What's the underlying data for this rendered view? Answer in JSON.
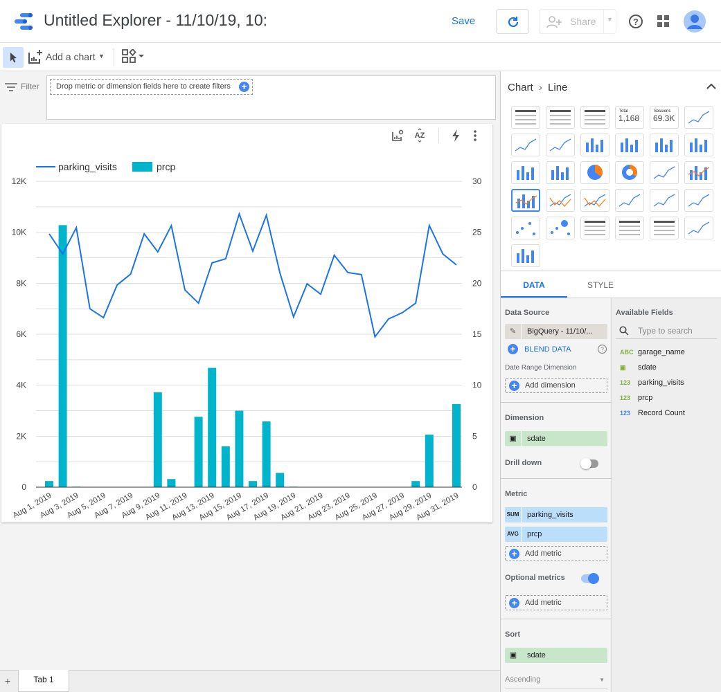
{
  "header": {
    "title": "Untitled Explorer - 11/10/19, 10:",
    "save_label": "Save",
    "share_label": "Share",
    "brand_color": "#4285f4"
  },
  "toolbar": {
    "add_chart_label": "Add a chart"
  },
  "filter": {
    "label": "Filter",
    "drop_hint": "Drop metric or dimension fields here to create filters"
  },
  "panel": {
    "breadcrumb_root": "Chart",
    "breadcrumb_leaf": "Line",
    "chart_types": [
      "table",
      "table-bars",
      "table-heatmap",
      "scorecard",
      "scorecard-compact",
      "time-series",
      "sparkline",
      "smoothed-time-series",
      "column",
      "stacked-column",
      "100-stacked-column",
      "bar",
      "stacked-bar",
      "100-stacked-bar",
      "pie",
      "donut",
      "geo-map",
      "combo",
      "stacked-combo",
      "line",
      "smoothed-line",
      "area",
      "stacked-area",
      "100-stacked-area",
      "scatter",
      "bubble",
      "pivot-table",
      "pivot-table-bars",
      "pivot-table-heatmap",
      "bullet",
      "treemap"
    ],
    "selected_chart_type": "stacked-combo",
    "scorecard1": {
      "label": "Total",
      "value": "1,168"
    },
    "scorecard2": {
      "label": "Sessions",
      "value": "69.3K"
    },
    "tabs": [
      "DATA",
      "STYLE"
    ],
    "active_tab": "DATA",
    "data_source_label": "Data Source",
    "data_source": "BigQuery - 11/10/...",
    "blend_label": "BLEND DATA",
    "date_range_label": "Date Range Dimension",
    "add_dimension": "Add dimension",
    "dimension_label": "Dimension",
    "dimension": "sdate",
    "drill_down_label": "Drill down",
    "drill_down_on": false,
    "metric_label": "Metric",
    "metrics": [
      {
        "agg": "SUM",
        "name": "parking_visits"
      },
      {
        "agg": "AVG",
        "name": "prcp"
      }
    ],
    "add_metric": "Add metric",
    "optional_metrics_label": "Optional metrics",
    "optional_metrics_on": true,
    "sort_label": "Sort",
    "sort_field": "sdate",
    "sort_order": "Ascending",
    "available_fields_label": "Available Fields",
    "search_placeholder": "Type to search",
    "fields": [
      {
        "type": "ABC",
        "name": "garage_name",
        "color": "#7cb342"
      },
      {
        "type": "date",
        "name": "sdate",
        "color": "#7cb342"
      },
      {
        "type": "123",
        "name": "parking_visits",
        "color": "#7cb342"
      },
      {
        "type": "123",
        "name": "prcp",
        "color": "#7cb342"
      },
      {
        "type": "123",
        "name": "Record Count",
        "color": "#4285f4"
      }
    ]
  },
  "tabs": {
    "page_tab": "Tab 1"
  },
  "chart_data": {
    "type": "combo",
    "categories": [
      "Aug 1, 2019",
      "Aug 2, 2019",
      "Aug 3, 2019",
      "Aug 4, 2019",
      "Aug 5, 2019",
      "Aug 6, 2019",
      "Aug 7, 2019",
      "Aug 8, 2019",
      "Aug 9, 2019",
      "Aug 10, 2019",
      "Aug 11, 2019",
      "Aug 12, 2019",
      "Aug 13, 2019",
      "Aug 14, 2019",
      "Aug 15, 2019",
      "Aug 16, 2019",
      "Aug 17, 2019",
      "Aug 18, 2019",
      "Aug 19, 2019",
      "Aug 20, 2019",
      "Aug 21, 2019",
      "Aug 22, 2019",
      "Aug 23, 2019",
      "Aug 24, 2019",
      "Aug 25, 2019",
      "Aug 26, 2019",
      "Aug 27, 2019",
      "Aug 28, 2019",
      "Aug 29, 2019",
      "Aug 30, 2019",
      "Aug 31, 2019"
    ],
    "series": [
      {
        "name": "parking_visits",
        "type": "line",
        "axis": "left",
        "color": "#1a73e8",
        "values": [
          9940,
          9150,
          10180,
          7000,
          6650,
          7930,
          8360,
          9940,
          9230,
          10260,
          7740,
          7220,
          8800,
          8960,
          10720,
          9260,
          10670,
          8400,
          6680,
          7980,
          7570,
          9100,
          8420,
          8340,
          5900,
          6600,
          6840,
          7220,
          10270,
          9150,
          8720
        ]
      },
      {
        "name": "prcp",
        "type": "bar",
        "axis": "right",
        "color": "#00b4cc",
        "values": [
          0.6,
          25.7,
          0.05,
          0,
          0,
          0,
          0,
          0,
          9.3,
          0.8,
          0,
          6.9,
          11.7,
          4.0,
          7.5,
          0.6,
          6.45,
          1.4,
          0.05,
          0,
          0,
          0,
          0,
          0,
          0,
          0,
          0,
          0.6,
          5.15,
          0,
          8.15
        ]
      }
    ],
    "y_left": {
      "range": [
        0,
        12000
      ],
      "ticks": [
        "0",
        "2K",
        "4K",
        "6K",
        "8K",
        "10K",
        "12K"
      ]
    },
    "y_right": {
      "range": [
        0,
        30
      ],
      "ticks": [
        "0",
        "5",
        "10",
        "15",
        "20",
        "25",
        "30"
      ]
    },
    "x_tick_labels": [
      "Aug 1, 2019",
      "Aug 3, 2019",
      "Aug 5, 2019",
      "Aug 7, 2019",
      "Aug 9, 2019",
      "Aug 11, 2019",
      "Aug 13, 2019",
      "Aug 15, 2019",
      "Aug 17, 2019",
      "Aug 19, 2019",
      "Aug 21, 2019",
      "Aug 23, 2019",
      "Aug 25, 2019",
      "Aug 27, 2019",
      "Aug 29, 2019",
      "Aug 31, 2019"
    ],
    "legend": "top-left",
    "grid": true
  }
}
